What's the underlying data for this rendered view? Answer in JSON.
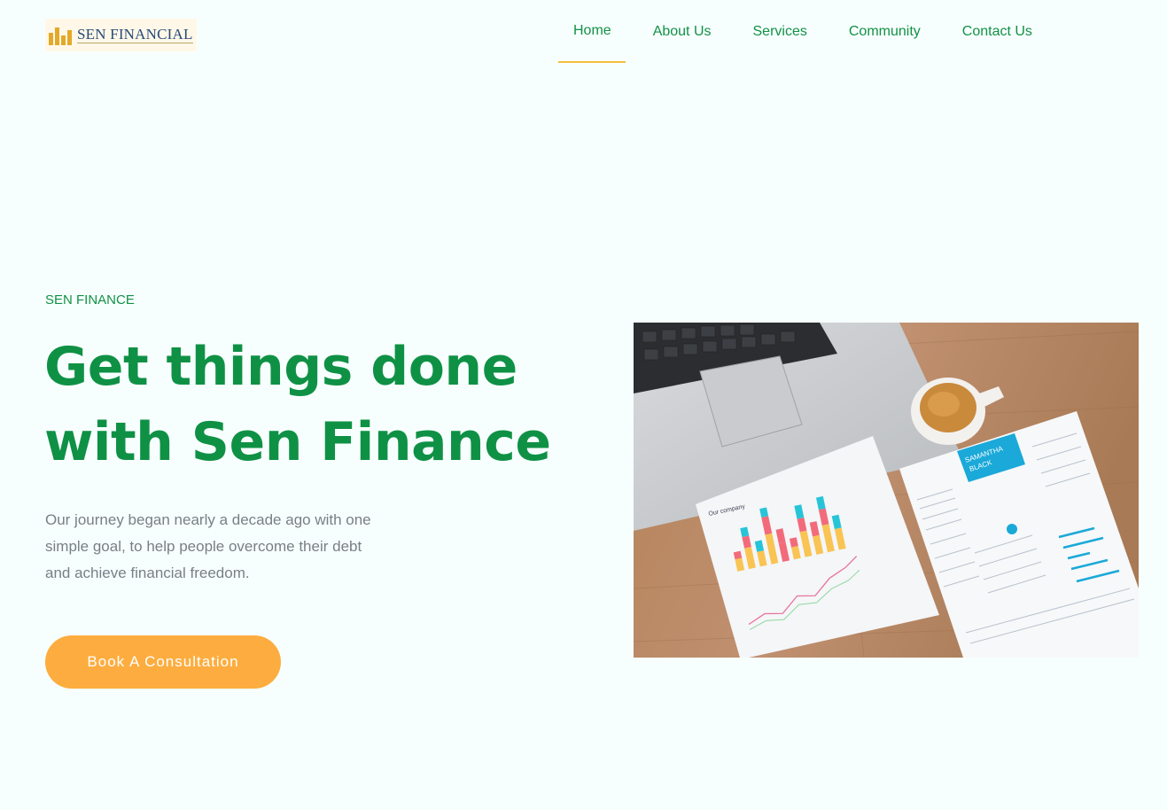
{
  "header": {
    "logo_text": "SEN FINANCIAL",
    "nav": [
      {
        "label": "Home",
        "active": true
      },
      {
        "label": "About Us"
      },
      {
        "label": "Services"
      },
      {
        "label": "Community"
      },
      {
        "label": "Contact Us"
      }
    ]
  },
  "hero": {
    "eyebrow": "SEN FINANCE",
    "title_line1": "Get things done",
    "title_line2": "with Sen Finance",
    "text_line1": "Our journey began nearly a decade ago with one",
    "text_line2": "simple goal, to help people overcome their debt",
    "text_line3": "and achieve financial freedom.",
    "cta_label": "Book A Consultation"
  },
  "photo": {
    "resume_name_line1": "SAMANTHA",
    "resume_name_line2": "BLACK",
    "chart_heading": "Our company"
  },
  "colors": {
    "brand_green": "#129146",
    "accent_orange": "#fdad3f",
    "nav_underline": "#f9bd3b",
    "background": "#f7fffe"
  }
}
